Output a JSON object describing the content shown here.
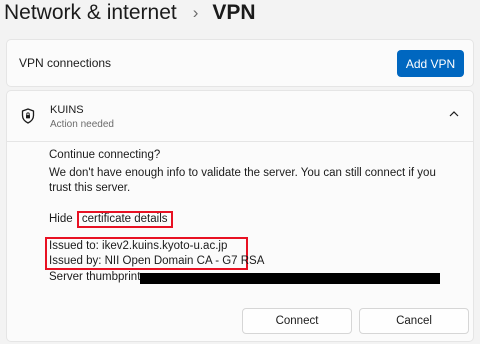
{
  "breadcrumb": {
    "parent": "Network & internet",
    "separator": "›",
    "current": "VPN"
  },
  "connections": {
    "label": "VPN connections",
    "add_button": "Add VPN"
  },
  "vpn": {
    "name": "KUINS",
    "status": "Action needed",
    "continue_text": "Continue connecting?",
    "info_text": "We don't have enough info to validate the server. You can still connect if you trust this server.",
    "hide_label": "Hide",
    "cert_link": "certificate details",
    "issued_to": "Issued to: ikev2.kuins.kyoto-u.ac.jp",
    "issued_by": "Issued by: NII Open Domain CA - G7 RSA",
    "thumbprint_label": "Server thumbprint:",
    "connect_button": "Connect",
    "cancel_button": "Cancel"
  },
  "colors": {
    "accent": "#0067c0",
    "highlight_box": "#e81123",
    "redaction": "#000000"
  },
  "icons": {
    "vpn": "shield-icon",
    "expand": "chevron-up-icon"
  }
}
